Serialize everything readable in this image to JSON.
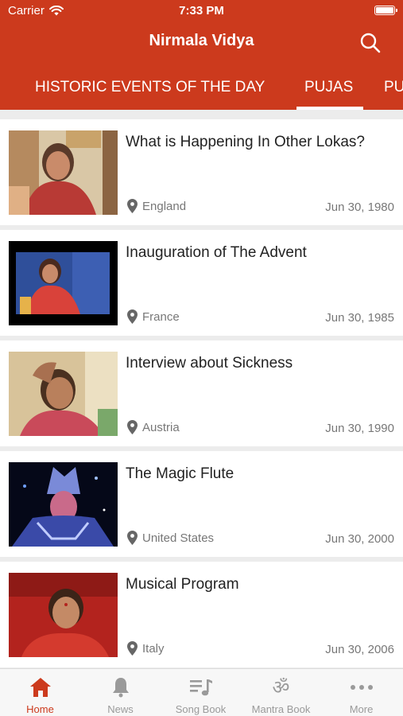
{
  "status": {
    "carrier": "Carrier",
    "time": "7:33 PM"
  },
  "header": {
    "title": "Nirmala Vidya"
  },
  "tabs": [
    {
      "label": "HISTORIC EVENTS OF THE DAY"
    },
    {
      "label": "PUJAS"
    },
    {
      "label": "PU"
    }
  ],
  "events": [
    {
      "title": "What is Happening In Other Lokas?",
      "location": "England",
      "date": "Jun 30, 1980"
    },
    {
      "title": "Inauguration of The Advent",
      "location": "France",
      "date": "Jun 30, 1985"
    },
    {
      "title": "Interview about Sickness",
      "location": "Austria",
      "date": "Jun 30, 1990"
    },
    {
      "title": "The Magic Flute",
      "location": "United States",
      "date": "Jun 30, 2000"
    },
    {
      "title": "Musical Program",
      "location": "Italy",
      "date": "Jun 30, 2006"
    }
  ],
  "bottom_nav": [
    {
      "label": "Home",
      "icon": "home-icon"
    },
    {
      "label": "News",
      "icon": "bell-icon"
    },
    {
      "label": "Song Book",
      "icon": "music-list-icon"
    },
    {
      "label": "Mantra Book",
      "icon": "om-icon"
    },
    {
      "label": "More",
      "icon": "more-dots-icon"
    }
  ],
  "colors": {
    "accent": "#cc3a1d",
    "inactive": "#9a9a9a",
    "background": "#ececec"
  }
}
